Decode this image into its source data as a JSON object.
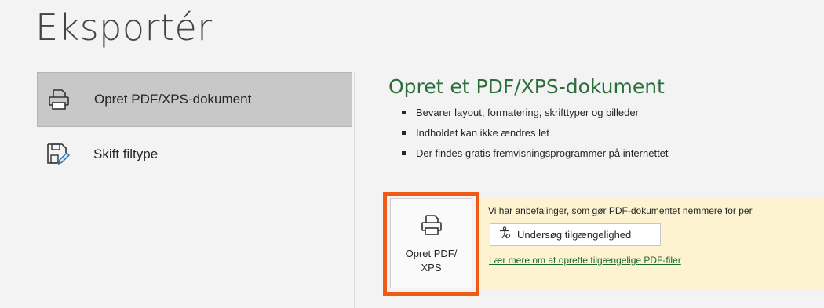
{
  "page": {
    "title": "Eksportér"
  },
  "nav": {
    "items": [
      {
        "label": "Opret PDF/XPS-dokument",
        "icon": "printer-icon",
        "selected": true
      },
      {
        "label": "Skift filtype",
        "icon": "save-as-icon",
        "selected": false
      }
    ]
  },
  "content": {
    "title": "Opret et PDF/XPS-dokument",
    "bullets": [
      "Bevarer layout, formatering, skrifttyper og billeder",
      "Indholdet kan ikke ændres let",
      "Der findes gratis fremvisningsprogrammer på internettet"
    ],
    "create_button": {
      "line1": "Opret PDF/",
      "line2": "XPS"
    },
    "info": {
      "text": "Vi har anbefalinger, som gør PDF-dokumentet nemmere for per",
      "check_button": "Undersøg tilgængelighed",
      "link": "Lær mere om at oprette tilgængelige PDF-filer"
    }
  },
  "colors": {
    "accent_green": "#2b6e3c",
    "highlight_orange": "#f05a14",
    "info_background": "#fdf3d0"
  }
}
